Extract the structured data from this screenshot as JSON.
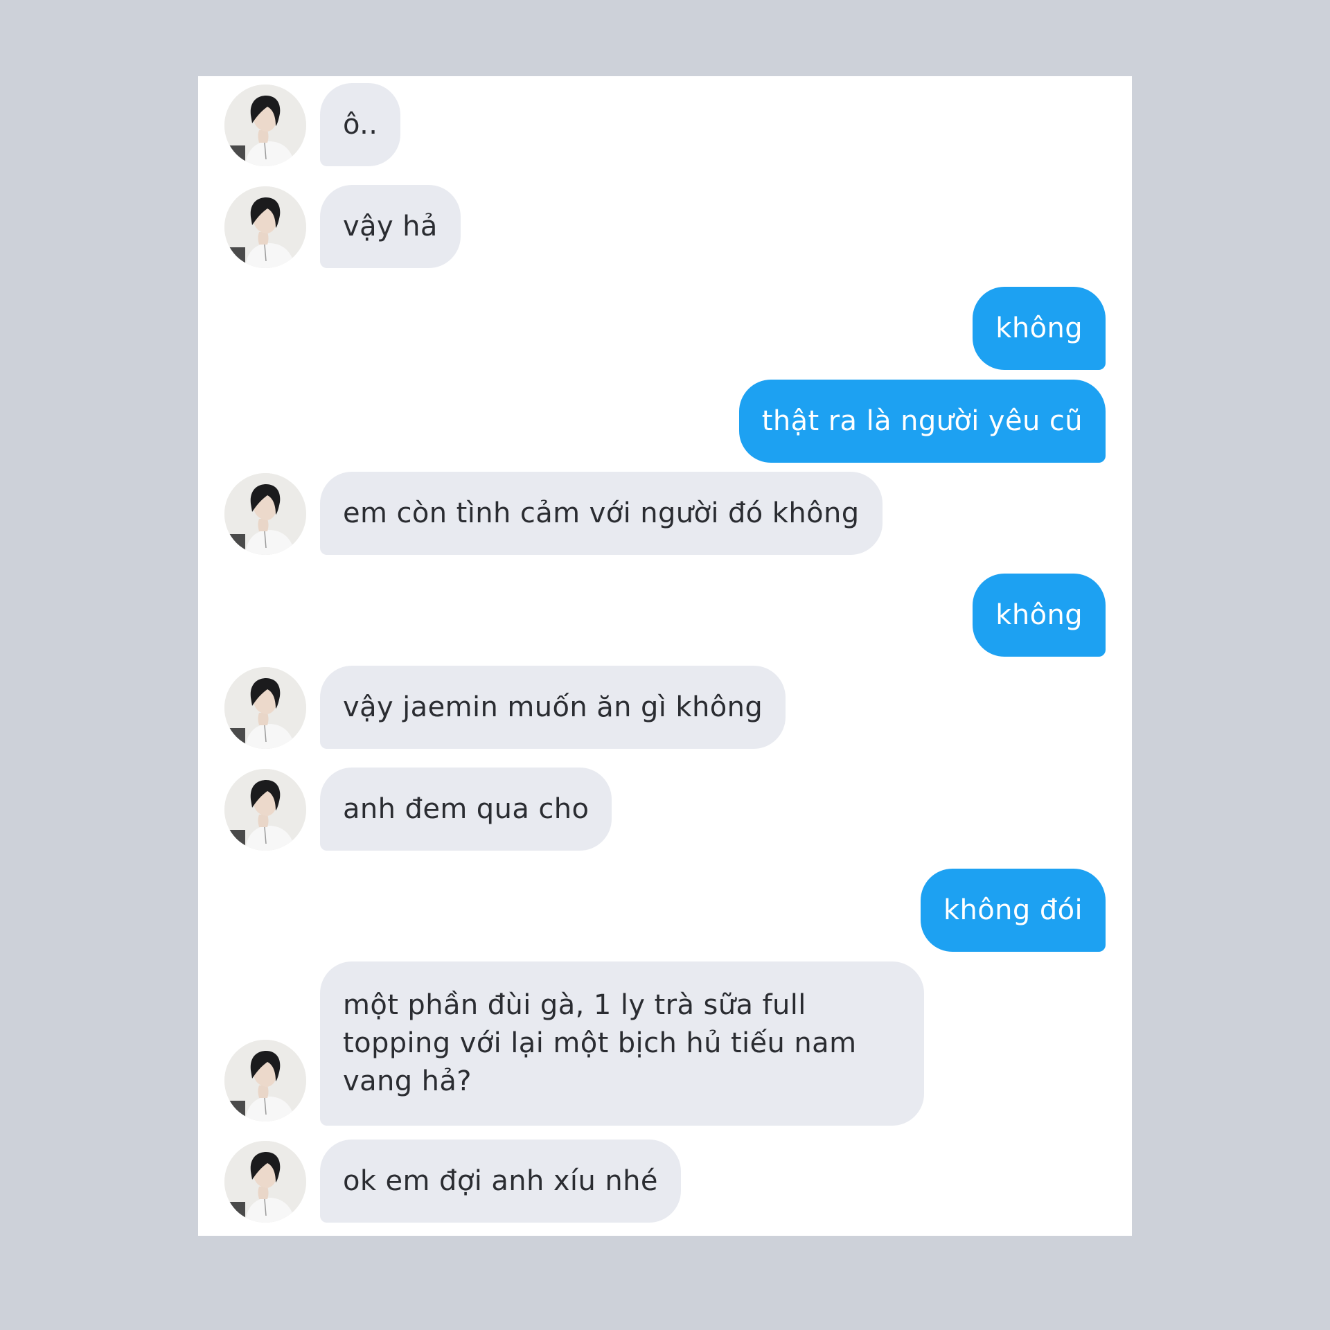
{
  "conversation": {
    "messages": [
      {
        "sender": "them",
        "text": "ô.."
      },
      {
        "sender": "them",
        "text": "vậy hả"
      },
      {
        "sender": "me",
        "text": "không"
      },
      {
        "sender": "me",
        "text": "thật ra là người yêu cũ"
      },
      {
        "sender": "them",
        "text": "em còn tình cảm với người đó không"
      },
      {
        "sender": "me",
        "text": "không"
      },
      {
        "sender": "them",
        "text": "vậy jaemin muốn ăn gì không"
      },
      {
        "sender": "them",
        "text": "anh đem qua cho"
      },
      {
        "sender": "me",
        "text": "không đói"
      },
      {
        "sender": "them",
        "text": "một phần đùi gà, 1 ly trà sữa full topping với lại một bịch hủ tiếu nam vang hả?"
      },
      {
        "sender": "them",
        "text": "ok em đợi anh xíu nhé"
      }
    ]
  },
  "colors": {
    "page_background": "#cdd1d9",
    "panel_background": "#ffffff",
    "incoming_bubble": "#e8eaf0",
    "outgoing_bubble": "#1da1f2",
    "incoming_text": "#2a2c31",
    "outgoing_text": "#ffffff"
  },
  "icons": {
    "avatar": "avatar-photo-icon"
  }
}
